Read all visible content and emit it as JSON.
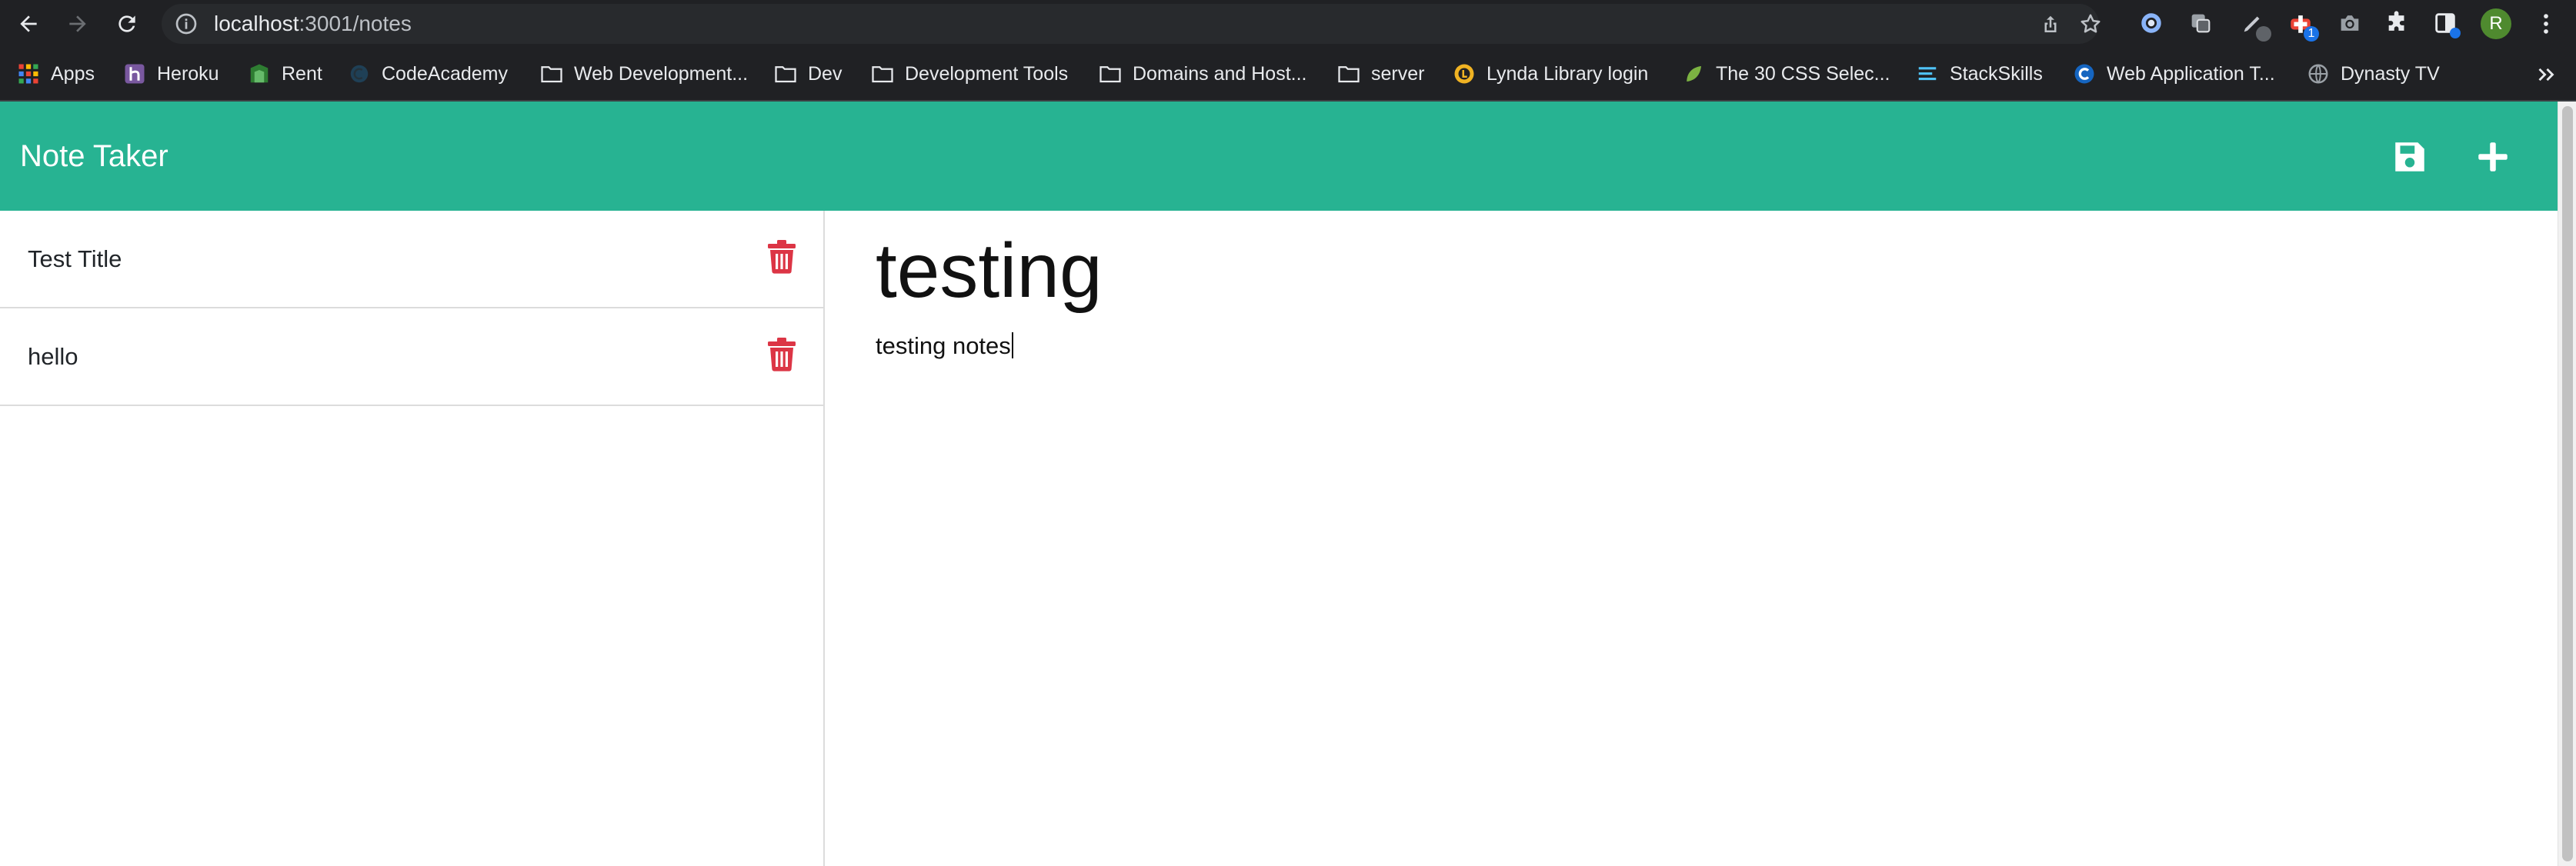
{
  "browser": {
    "url_host": "localhost",
    "url_path": ":3001/notes",
    "bookmarks": [
      {
        "label": "Apps",
        "icon": "apps-grid-icon"
      },
      {
        "label": "Heroku",
        "icon": "heroku-icon"
      },
      {
        "label": "Rent",
        "icon": "rent-icon"
      },
      {
        "label": "CodeAcademy",
        "icon": "codeacademy-icon"
      },
      {
        "label": "Web Development...",
        "icon": "folder-icon"
      },
      {
        "label": "Dev",
        "icon": "folder-icon"
      },
      {
        "label": "Development Tools",
        "icon": "folder-icon"
      },
      {
        "label": "Domains and Host...",
        "icon": "folder-icon"
      },
      {
        "label": "server",
        "icon": "folder-icon"
      },
      {
        "label": "Lynda Library login",
        "icon": "lynda-icon"
      },
      {
        "label": "The 30 CSS Selec...",
        "icon": "leaf-icon"
      },
      {
        "label": "StackSkills",
        "icon": "stackskills-icon"
      },
      {
        "label": "Web Application T...",
        "icon": "c-logo-icon"
      },
      {
        "label": "Dynasty TV",
        "icon": "globe-icon"
      }
    ],
    "extension_badge": "1",
    "profile_initial": "R"
  },
  "app": {
    "brand": "Note Taker",
    "accent_color": "#27b392",
    "delete_color": "#dc3545",
    "notes": [
      {
        "title": "Test Title"
      },
      {
        "title": "hello"
      }
    ],
    "active_note": {
      "title": "testing",
      "text": "testing notes"
    }
  }
}
